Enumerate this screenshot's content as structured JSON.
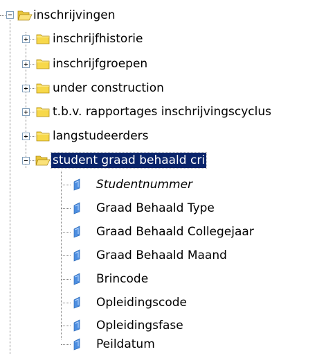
{
  "tree": {
    "root": {
      "label": "inschrijvingen",
      "expander": "minus",
      "icon": "folder-open-icon"
    },
    "folders": [
      {
        "label": "inschrijfhistorie",
        "expander": "plus",
        "icon": "folder-closed-icon"
      },
      {
        "label": "inschrijfgroepen",
        "expander": "plus",
        "icon": "folder-closed-icon"
      },
      {
        "label": "under construction",
        "expander": "plus",
        "icon": "folder-closed-icon"
      },
      {
        "label": "t.b.v. rapportages inschrijvingscyclus",
        "expander": "plus",
        "icon": "folder-closed-icon"
      },
      {
        "label": "langstudeerders",
        "expander": "plus",
        "icon": "folder-closed-icon"
      },
      {
        "label": "student graad behaald cri",
        "expander": "minus",
        "icon": "folder-open-icon",
        "selected": true
      }
    ],
    "fields": [
      {
        "label": "Studentnummer",
        "italic": true,
        "icon": "field-icon"
      },
      {
        "label": "Graad Behaald Type",
        "icon": "field-icon"
      },
      {
        "label": "Graad Behaald Collegejaar",
        "icon": "field-icon"
      },
      {
        "label": "Graad Behaald Maand",
        "icon": "field-icon"
      },
      {
        "label": "Brincode",
        "icon": "field-icon"
      },
      {
        "label": "Opleidingscode",
        "icon": "field-icon"
      },
      {
        "label": "Opleidingsfase",
        "icon": "field-icon"
      },
      {
        "label": "Peildatum",
        "icon": "field-icon"
      }
    ]
  },
  "colors": {
    "selection_bg": "#0a246a",
    "selection_text": "#ffffff",
    "folder_yellow": "#f7d84a",
    "field_blue": "#4d8ee0"
  }
}
